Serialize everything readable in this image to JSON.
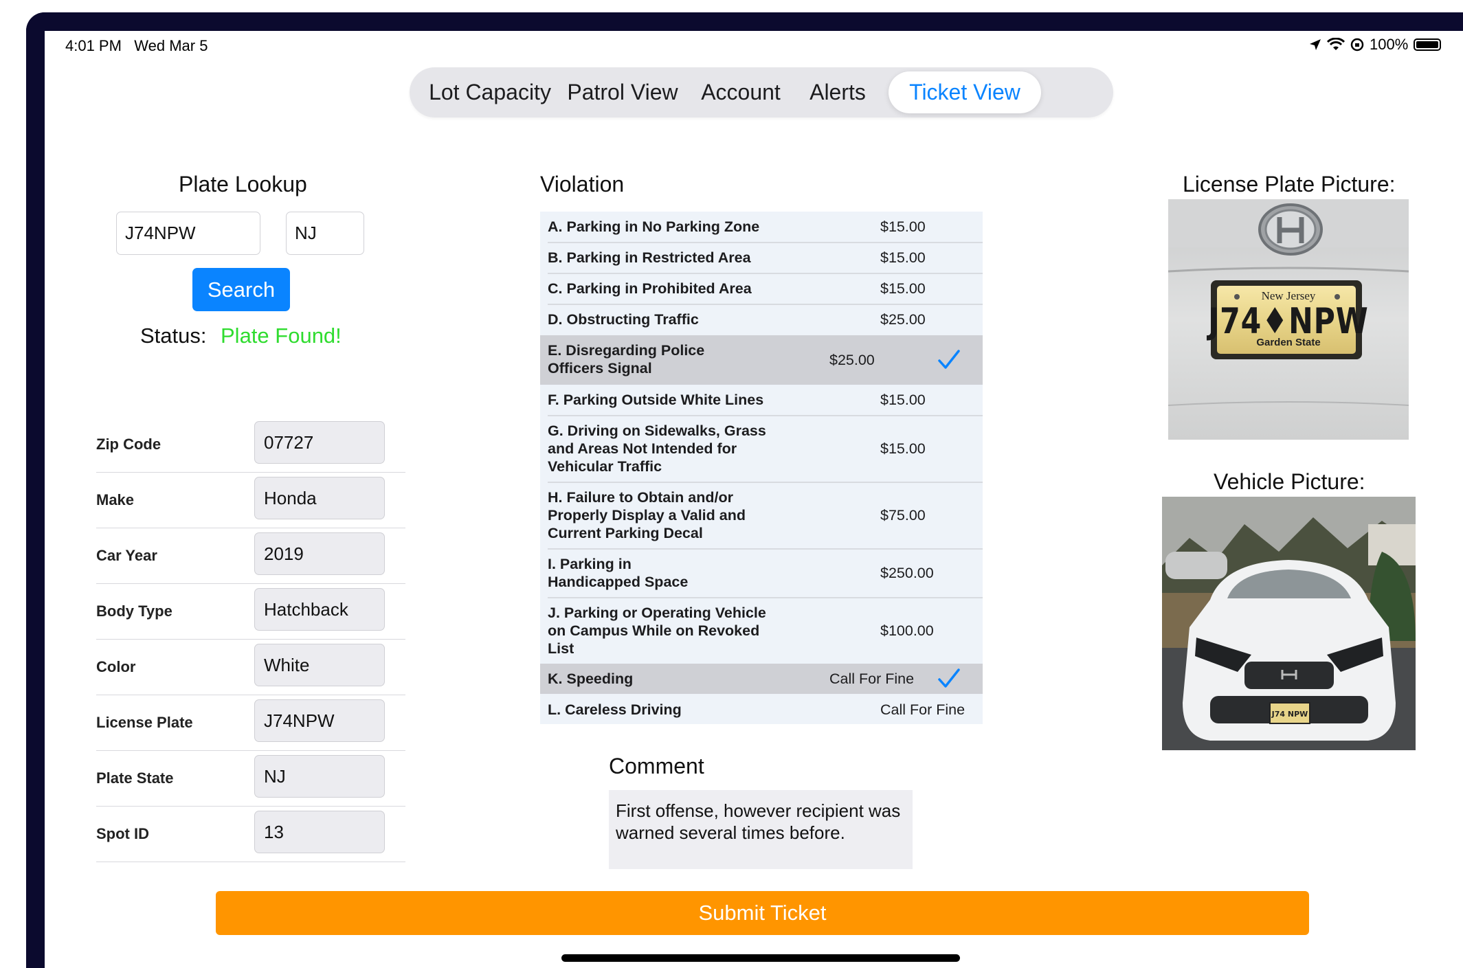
{
  "status_bar": {
    "time": "4:01 PM",
    "date": "Wed Mar 5",
    "battery": "100%",
    "battery_level": 1.0
  },
  "tabs": [
    {
      "label": "Lot Capacity",
      "active": false
    },
    {
      "label": "Patrol View",
      "active": false
    },
    {
      "label": "Account",
      "active": false
    },
    {
      "label": "Alerts",
      "active": false
    },
    {
      "label": "Ticket View",
      "active": true
    }
  ],
  "plate_lookup": {
    "title": "Plate Lookup",
    "plate_value": "J74NPW",
    "state_value": "NJ",
    "search_label": "Search",
    "status_label": "Status:",
    "status_value": "Plate Found!",
    "status_color": "#2fdc2f"
  },
  "vehicle": [
    {
      "label": "Zip Code",
      "value": "07727"
    },
    {
      "label": "Make",
      "value": "Honda"
    },
    {
      "label": "Car Year",
      "value": "2019"
    },
    {
      "label": "Body Type",
      "value": "Hatchback"
    },
    {
      "label": "Color",
      "value": "White"
    },
    {
      "label": "License Plate",
      "value": "J74NPW"
    },
    {
      "label": "Plate State",
      "value": "NJ"
    },
    {
      "label": "Spot ID",
      "value": "13"
    }
  ],
  "violation": {
    "title": "Violation",
    "items": [
      {
        "name": "A. Parking in No Parking Zone",
        "fine": "$15.00",
        "selected": false
      },
      {
        "name": "B. Parking in Restricted Area",
        "fine": "$15.00",
        "selected": false
      },
      {
        "name": "C. Parking in Prohibited Area",
        "fine": "$15.00",
        "selected": false
      },
      {
        "name": "D. Obstructing Traffic",
        "fine": "$25.00",
        "selected": false
      },
      {
        "name": "E. Disregarding Police Officers Signal",
        "fine": "$25.00",
        "selected": true
      },
      {
        "name": "F. Parking Outside White Lines",
        "fine": "$15.00",
        "selected": false
      },
      {
        "name": "G. Driving on Sidewalks, Grass and Areas Not Intended for Vehicular Traffic",
        "fine": "$15.00",
        "selected": false
      },
      {
        "name": "H. Failure to Obtain and/or Properly Display a Valid and Current Parking Decal",
        "fine": "$75.00",
        "selected": false
      },
      {
        "name": "I. Parking in Handicapped Space",
        "fine": "$250.00",
        "selected": false
      },
      {
        "name": "J. Parking or Operating Vehicle on Campus While on Revoked List",
        "fine": "$100.00",
        "selected": false
      },
      {
        "name": "K. Speeding",
        "fine": "Call For Fine",
        "selected": true
      },
      {
        "name": "L. Careless Driving",
        "fine": "Call For Fine",
        "selected": false
      }
    ]
  },
  "comment": {
    "title": "Comment",
    "value": "First offense, however recipient was warned several times before."
  },
  "license_plate_picture": {
    "title": "License Plate Picture:",
    "plate_text": "J74♦NPW",
    "plate_header": "New Jersey",
    "plate_footer": "Garden State"
  },
  "vehicle_picture": {
    "title": "Vehicle Picture:"
  },
  "submit_label": "Submit Ticket"
}
